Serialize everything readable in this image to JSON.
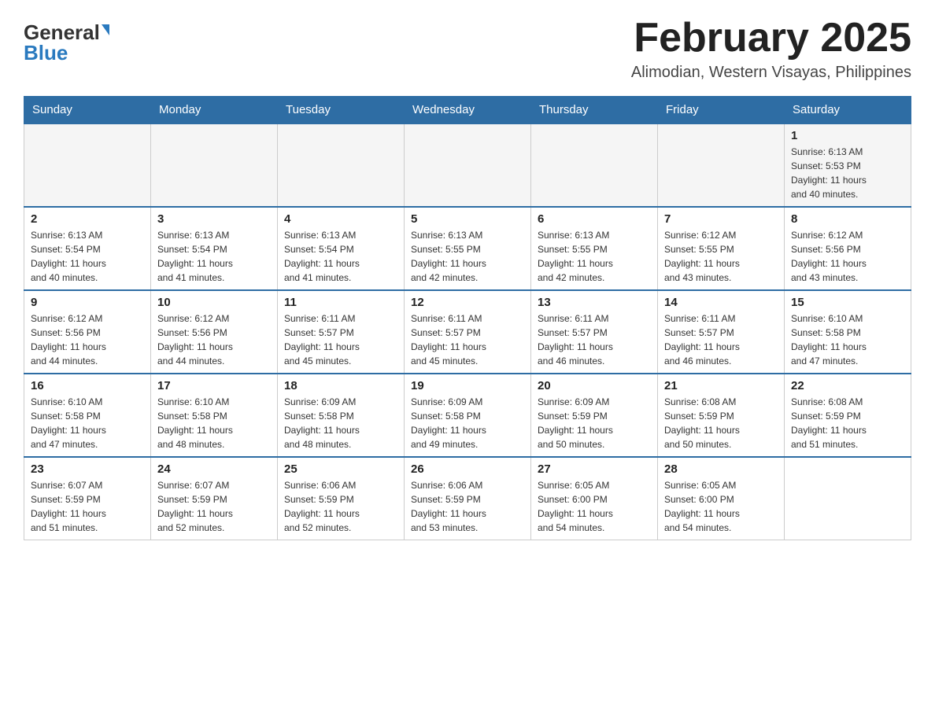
{
  "header": {
    "logo": {
      "general": "General",
      "blue": "Blue"
    },
    "title": "February 2025",
    "location": "Alimodian, Western Visayas, Philippines"
  },
  "days_of_week": [
    "Sunday",
    "Monday",
    "Tuesday",
    "Wednesday",
    "Thursday",
    "Friday",
    "Saturday"
  ],
  "weeks": [
    {
      "cells": [
        {
          "day": "",
          "info": ""
        },
        {
          "day": "",
          "info": ""
        },
        {
          "day": "",
          "info": ""
        },
        {
          "day": "",
          "info": ""
        },
        {
          "day": "",
          "info": ""
        },
        {
          "day": "",
          "info": ""
        },
        {
          "day": "1",
          "info": "Sunrise: 6:13 AM\nSunset: 5:53 PM\nDaylight: 11 hours\nand 40 minutes."
        }
      ]
    },
    {
      "cells": [
        {
          "day": "2",
          "info": "Sunrise: 6:13 AM\nSunset: 5:54 PM\nDaylight: 11 hours\nand 40 minutes."
        },
        {
          "day": "3",
          "info": "Sunrise: 6:13 AM\nSunset: 5:54 PM\nDaylight: 11 hours\nand 41 minutes."
        },
        {
          "day": "4",
          "info": "Sunrise: 6:13 AM\nSunset: 5:54 PM\nDaylight: 11 hours\nand 41 minutes."
        },
        {
          "day": "5",
          "info": "Sunrise: 6:13 AM\nSunset: 5:55 PM\nDaylight: 11 hours\nand 42 minutes."
        },
        {
          "day": "6",
          "info": "Sunrise: 6:13 AM\nSunset: 5:55 PM\nDaylight: 11 hours\nand 42 minutes."
        },
        {
          "day": "7",
          "info": "Sunrise: 6:12 AM\nSunset: 5:55 PM\nDaylight: 11 hours\nand 43 minutes."
        },
        {
          "day": "8",
          "info": "Sunrise: 6:12 AM\nSunset: 5:56 PM\nDaylight: 11 hours\nand 43 minutes."
        }
      ]
    },
    {
      "cells": [
        {
          "day": "9",
          "info": "Sunrise: 6:12 AM\nSunset: 5:56 PM\nDaylight: 11 hours\nand 44 minutes."
        },
        {
          "day": "10",
          "info": "Sunrise: 6:12 AM\nSunset: 5:56 PM\nDaylight: 11 hours\nand 44 minutes."
        },
        {
          "day": "11",
          "info": "Sunrise: 6:11 AM\nSunset: 5:57 PM\nDaylight: 11 hours\nand 45 minutes."
        },
        {
          "day": "12",
          "info": "Sunrise: 6:11 AM\nSunset: 5:57 PM\nDaylight: 11 hours\nand 45 minutes."
        },
        {
          "day": "13",
          "info": "Sunrise: 6:11 AM\nSunset: 5:57 PM\nDaylight: 11 hours\nand 46 minutes."
        },
        {
          "day": "14",
          "info": "Sunrise: 6:11 AM\nSunset: 5:57 PM\nDaylight: 11 hours\nand 46 minutes."
        },
        {
          "day": "15",
          "info": "Sunrise: 6:10 AM\nSunset: 5:58 PM\nDaylight: 11 hours\nand 47 minutes."
        }
      ]
    },
    {
      "cells": [
        {
          "day": "16",
          "info": "Sunrise: 6:10 AM\nSunset: 5:58 PM\nDaylight: 11 hours\nand 47 minutes."
        },
        {
          "day": "17",
          "info": "Sunrise: 6:10 AM\nSunset: 5:58 PM\nDaylight: 11 hours\nand 48 minutes."
        },
        {
          "day": "18",
          "info": "Sunrise: 6:09 AM\nSunset: 5:58 PM\nDaylight: 11 hours\nand 48 minutes."
        },
        {
          "day": "19",
          "info": "Sunrise: 6:09 AM\nSunset: 5:58 PM\nDaylight: 11 hours\nand 49 minutes."
        },
        {
          "day": "20",
          "info": "Sunrise: 6:09 AM\nSunset: 5:59 PM\nDaylight: 11 hours\nand 50 minutes."
        },
        {
          "day": "21",
          "info": "Sunrise: 6:08 AM\nSunset: 5:59 PM\nDaylight: 11 hours\nand 50 minutes."
        },
        {
          "day": "22",
          "info": "Sunrise: 6:08 AM\nSunset: 5:59 PM\nDaylight: 11 hours\nand 51 minutes."
        }
      ]
    },
    {
      "cells": [
        {
          "day": "23",
          "info": "Sunrise: 6:07 AM\nSunset: 5:59 PM\nDaylight: 11 hours\nand 51 minutes."
        },
        {
          "day": "24",
          "info": "Sunrise: 6:07 AM\nSunset: 5:59 PM\nDaylight: 11 hours\nand 52 minutes."
        },
        {
          "day": "25",
          "info": "Sunrise: 6:06 AM\nSunset: 5:59 PM\nDaylight: 11 hours\nand 52 minutes."
        },
        {
          "day": "26",
          "info": "Sunrise: 6:06 AM\nSunset: 5:59 PM\nDaylight: 11 hours\nand 53 minutes."
        },
        {
          "day": "27",
          "info": "Sunrise: 6:05 AM\nSunset: 6:00 PM\nDaylight: 11 hours\nand 54 minutes."
        },
        {
          "day": "28",
          "info": "Sunrise: 6:05 AM\nSunset: 6:00 PM\nDaylight: 11 hours\nand 54 minutes."
        },
        {
          "day": "",
          "info": ""
        }
      ]
    }
  ]
}
